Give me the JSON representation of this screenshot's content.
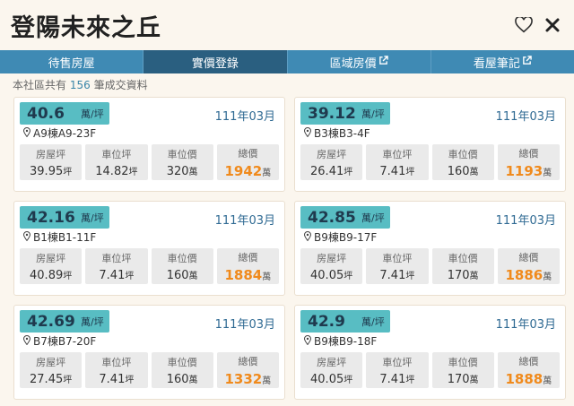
{
  "header": {
    "title": "登陽未來之丘",
    "favorite_icon": "heart-icon",
    "close_icon": "close-icon"
  },
  "tabs": [
    {
      "label": "待售房屋",
      "active": false,
      "external": false
    },
    {
      "label": "實價登錄",
      "active": true,
      "external": false
    },
    {
      "label": "區域房價",
      "active": false,
      "external": true
    },
    {
      "label": "看屋筆記",
      "active": false,
      "external": true
    }
  ],
  "summary": {
    "prefix": "本社區共有",
    "count": "156",
    "suffix": "筆成交資料"
  },
  "stat_labels": {
    "area": "房屋坪",
    "parking_area": "車位坪",
    "parking_price": "車位價",
    "total": "總價"
  },
  "units": {
    "unit_price": "萬/坪",
    "ping": "坪",
    "wan": "萬"
  },
  "accent_colors": {
    "tab_bar": "#3f8ab4",
    "tab_active": "#2a5f80",
    "price_tag": "#58bdc3",
    "total_price": "#f08a1c"
  },
  "records": [
    {
      "unit_price": "40.6",
      "date": "111年03月",
      "location": "A9棟A9-23F",
      "area": "39.95",
      "parking_area": "14.82",
      "parking_price": "320",
      "total": "1942"
    },
    {
      "unit_price": "39.12",
      "date": "111年03月",
      "location": "B3棟B3-4F",
      "area": "26.41",
      "parking_area": "7.41",
      "parking_price": "160",
      "total": "1193"
    },
    {
      "unit_price": "42.16",
      "date": "111年03月",
      "location": "B1棟B1-11F",
      "area": "40.89",
      "parking_area": "7.41",
      "parking_price": "160",
      "total": "1884"
    },
    {
      "unit_price": "42.85",
      "date": "111年03月",
      "location": "B9棟B9-17F",
      "area": "40.05",
      "parking_area": "7.41",
      "parking_price": "170",
      "total": "1886"
    },
    {
      "unit_price": "42.69",
      "date": "111年03月",
      "location": "B7棟B7-20F",
      "area": "27.45",
      "parking_area": "7.41",
      "parking_price": "160",
      "total": "1332"
    },
    {
      "unit_price": "42.9",
      "date": "111年03月",
      "location": "B9棟B9-18F",
      "area": "40.05",
      "parking_area": "7.41",
      "parking_price": "170",
      "total": "1888"
    }
  ]
}
